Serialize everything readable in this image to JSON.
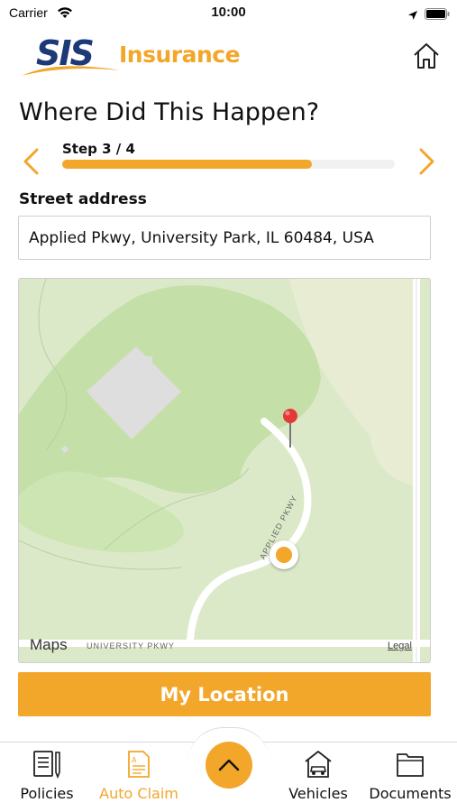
{
  "status_bar": {
    "carrier": "Carrier",
    "time": "10:00",
    "icons": [
      "wifi-icon",
      "location-arrow-icon",
      "battery-icon"
    ]
  },
  "header": {
    "logo_primary": "SIS",
    "logo_secondary": "Insurance",
    "home_icon": "home-icon"
  },
  "page": {
    "title": "Where Did This Happen?"
  },
  "stepper": {
    "label": "Step 3 / 4",
    "progress_fraction": 0.75,
    "prev_icon": "chevron-left-icon",
    "next_icon": "chevron-right-icon"
  },
  "address": {
    "label": "Street address",
    "value": "Applied Pkwy, University Park, IL 60484, USA"
  },
  "map": {
    "brand": "Maps",
    "legal": "Legal",
    "road_labels": {
      "university": "UNIVERSITY PKWY",
      "applied": "APPLIED PKWY"
    }
  },
  "actions": {
    "my_location": "My Location"
  },
  "tab_bar": {
    "items": [
      {
        "label": "Policies",
        "icon": "policies-icon",
        "active": false
      },
      {
        "label": "Auto Claim",
        "icon": "auto-claim-icon",
        "active": true
      },
      {
        "label": "Vehicles",
        "icon": "vehicles-icon",
        "active": false
      },
      {
        "label": "Documents",
        "icon": "documents-icon",
        "active": false
      }
    ],
    "center_icon": "chevron-up-icon"
  },
  "colors": {
    "accent": "#f2a62a",
    "brand_navy": "#1d3a78",
    "map_green": "#d6e8bf",
    "map_pin": "#e53935"
  }
}
